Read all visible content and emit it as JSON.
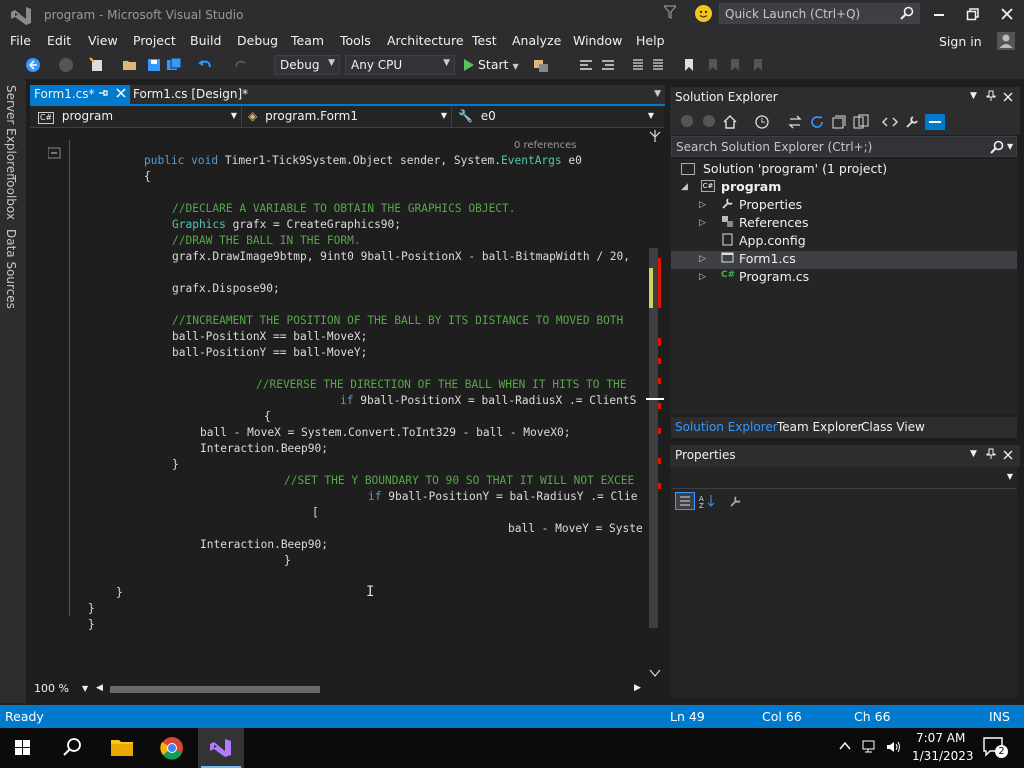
{
  "window": {
    "title": "program - Microsoft Visual Studio",
    "quick_launch_placeholder": "Quick Launch (Ctrl+Q)"
  },
  "menu": [
    "File",
    "Edit",
    "View",
    "Project",
    "Build",
    "Debug",
    "Team",
    "Tools",
    "Architecture",
    "Test",
    "Analyze",
    "Window",
    "Help"
  ],
  "account": {
    "signin_label": "Sign in"
  },
  "toolbar": {
    "config": "Debug",
    "platform": "Any CPU",
    "start_label": "Start"
  },
  "left_strip": [
    "Server Explorer",
    "Toolbox",
    "Data Sources"
  ],
  "editor": {
    "tabs": {
      "active": "Form1.cs*",
      "inactive": "Form1.cs [Design]*"
    },
    "nav": {
      "project": "program",
      "class": "program.Form1",
      "member": "e0"
    },
    "codelens": "0 references",
    "zoom": "100 %",
    "lines": [
      {
        "text": "public void Timer1-Tick9System.Object sender, System.EventArgs e0",
        "kind": "code"
      },
      {
        "text": "{",
        "kind": "code"
      },
      {
        "text": "//DECLARE A VARIABLE TO OBTAIN THE GRAPHICS OBJECT.",
        "kind": "comment"
      },
      {
        "text": "Graphics grafx = CreateGraphics90;",
        "kind": "code"
      },
      {
        "text": "//DRAW THE BALL IN THE FORM.",
        "kind": "comment"
      },
      {
        "text": "grafx.DrawImage9btmp, 9int0 9ball-PositionX - ball-BitmapWidth / 20,",
        "kind": "code"
      },
      {
        "text": "grafx.Dispose90;",
        "kind": "code"
      },
      {
        "text": "//INCREAMENT THE POSITION OF THE BALL BY ITS DISTANCE TO MOVED BOTH",
        "kind": "comment"
      },
      {
        "text": "ball-PositionX == ball-MoveX;",
        "kind": "code"
      },
      {
        "text": "ball-PositionY == ball-MoveY;",
        "kind": "code"
      },
      {
        "text": "//REVERSE THE DIRECTION OF THE BALL WHEN IT HITS TO THE",
        "kind": "comment"
      },
      {
        "text": "if 9ball-PositionX = ball-RadiusX .= ClientS",
        "kind": "code"
      },
      {
        "text": "{",
        "kind": "code"
      },
      {
        "text": "ball - MoveX = System.Convert.ToInt329 - ball - MoveX0;",
        "kind": "code"
      },
      {
        "text": "Interaction.Beep90;",
        "kind": "code"
      },
      {
        "text": "}",
        "kind": "code"
      },
      {
        "text": "//SET THE Y BOUNDARY TO 90 SO THAT IT WILL NOT EXCEE",
        "kind": "comment"
      },
      {
        "text": "if 9ball-PositionY = bal-RadiusY .= Clie",
        "kind": "code"
      },
      {
        "text": "[",
        "kind": "code"
      },
      {
        "text": "ball - MoveY = Syste",
        "kind": "code"
      },
      {
        "text": "Interaction.Beep90;",
        "kind": "code"
      },
      {
        "text": "}",
        "kind": "code"
      },
      {
        "text": "}",
        "kind": "code"
      },
      {
        "text": "}",
        "kind": "code"
      },
      {
        "text": "}",
        "kind": "code"
      }
    ]
  },
  "solution_explorer": {
    "title": "Solution Explorer",
    "search_placeholder": "Search Solution Explorer (Ctrl+;)",
    "solution": "Solution 'program' (1 project)",
    "project": "program",
    "items": [
      "Properties",
      "References",
      "App.config",
      "Form1.cs",
      "Program.cs"
    ],
    "tabs": [
      "Solution Explorer",
      "Team Explorer",
      "Class View"
    ]
  },
  "properties": {
    "title": "Properties"
  },
  "status": {
    "state": "Ready",
    "line": "Ln 49",
    "col": "Col 66",
    "ch": "Ch 66",
    "mode": "INS"
  },
  "taskbar": {
    "time": "7:07 AM",
    "date": "1/31/2023",
    "notification_count": "2"
  },
  "colors": {
    "accent": "#007acc",
    "keyword": "#569cd6",
    "comment": "#57a64a",
    "type": "#4ec9b0"
  }
}
